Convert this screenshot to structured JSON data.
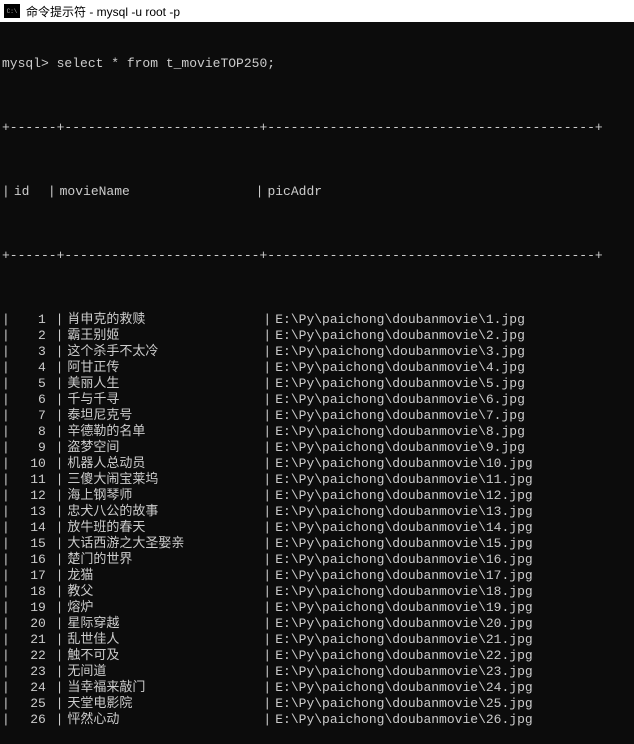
{
  "window": {
    "title": "命令提示符 - mysql  -u root -p"
  },
  "terminal": {
    "prompt": "mysql>",
    "sql": " select * from t_movieTOP250;"
  },
  "table": {
    "sep_top": "+------+-------------------------+------------------------------------------+",
    "headers": {
      "id": "id",
      "movieName": "movieName",
      "picAddr": "picAddr"
    },
    "rows": [
      {
        "id": "1",
        "movieName": "肖申克的救赎",
        "picAddr": "E:\\Py\\paichong\\doubanmovie\\1.jpg"
      },
      {
        "id": "2",
        "movieName": "霸王别姬",
        "picAddr": "E:\\Py\\paichong\\doubanmovie\\2.jpg"
      },
      {
        "id": "3",
        "movieName": "这个杀手不太冷",
        "picAddr": "E:\\Py\\paichong\\doubanmovie\\3.jpg"
      },
      {
        "id": "4",
        "movieName": "阿甘正传",
        "picAddr": "E:\\Py\\paichong\\doubanmovie\\4.jpg"
      },
      {
        "id": "5",
        "movieName": "美丽人生",
        "picAddr": "E:\\Py\\paichong\\doubanmovie\\5.jpg"
      },
      {
        "id": "6",
        "movieName": "千与千寻",
        "picAddr": "E:\\Py\\paichong\\doubanmovie\\6.jpg"
      },
      {
        "id": "7",
        "movieName": "泰坦尼克号",
        "picAddr": "E:\\Py\\paichong\\doubanmovie\\7.jpg"
      },
      {
        "id": "8",
        "movieName": "辛德勒的名单",
        "picAddr": "E:\\Py\\paichong\\doubanmovie\\8.jpg"
      },
      {
        "id": "9",
        "movieName": "盗梦空间",
        "picAddr": "E:\\Py\\paichong\\doubanmovie\\9.jpg"
      },
      {
        "id": "10",
        "movieName": "机器人总动员",
        "picAddr": "E:\\Py\\paichong\\doubanmovie\\10.jpg"
      },
      {
        "id": "11",
        "movieName": "三傻大闹宝莱坞",
        "picAddr": "E:\\Py\\paichong\\doubanmovie\\11.jpg"
      },
      {
        "id": "12",
        "movieName": "海上钢琴师",
        "picAddr": "E:\\Py\\paichong\\doubanmovie\\12.jpg"
      },
      {
        "id": "13",
        "movieName": "忠犬八公的故事",
        "picAddr": "E:\\Py\\paichong\\doubanmovie\\13.jpg"
      },
      {
        "id": "14",
        "movieName": "放牛班的春天",
        "picAddr": "E:\\Py\\paichong\\doubanmovie\\14.jpg"
      },
      {
        "id": "15",
        "movieName": "大话西游之大圣娶亲",
        "picAddr": "E:\\Py\\paichong\\doubanmovie\\15.jpg"
      },
      {
        "id": "16",
        "movieName": "楚门的世界",
        "picAddr": "E:\\Py\\paichong\\doubanmovie\\16.jpg"
      },
      {
        "id": "17",
        "movieName": "龙猫",
        "picAddr": "E:\\Py\\paichong\\doubanmovie\\17.jpg"
      },
      {
        "id": "18",
        "movieName": "教父",
        "picAddr": "E:\\Py\\paichong\\doubanmovie\\18.jpg"
      },
      {
        "id": "19",
        "movieName": "熔炉",
        "picAddr": "E:\\Py\\paichong\\doubanmovie\\19.jpg"
      },
      {
        "id": "20",
        "movieName": "星际穿越",
        "picAddr": "E:\\Py\\paichong\\doubanmovie\\20.jpg"
      },
      {
        "id": "21",
        "movieName": "乱世佳人",
        "picAddr": "E:\\Py\\paichong\\doubanmovie\\21.jpg"
      },
      {
        "id": "22",
        "movieName": "触不可及",
        "picAddr": "E:\\Py\\paichong\\doubanmovie\\22.jpg"
      },
      {
        "id": "23",
        "movieName": "无间道",
        "picAddr": "E:\\Py\\paichong\\doubanmovie\\23.jpg"
      },
      {
        "id": "24",
        "movieName": "当幸福来敲门",
        "picAddr": "E:\\Py\\paichong\\doubanmovie\\24.jpg"
      },
      {
        "id": "25",
        "movieName": "天堂电影院",
        "picAddr": "E:\\Py\\paichong\\doubanmovie\\25.jpg"
      },
      {
        "id": "26",
        "movieName": "怦然心动",
        "picAddr": "E:\\Py\\paichong\\doubanmovie\\26.jpg"
      }
    ]
  }
}
